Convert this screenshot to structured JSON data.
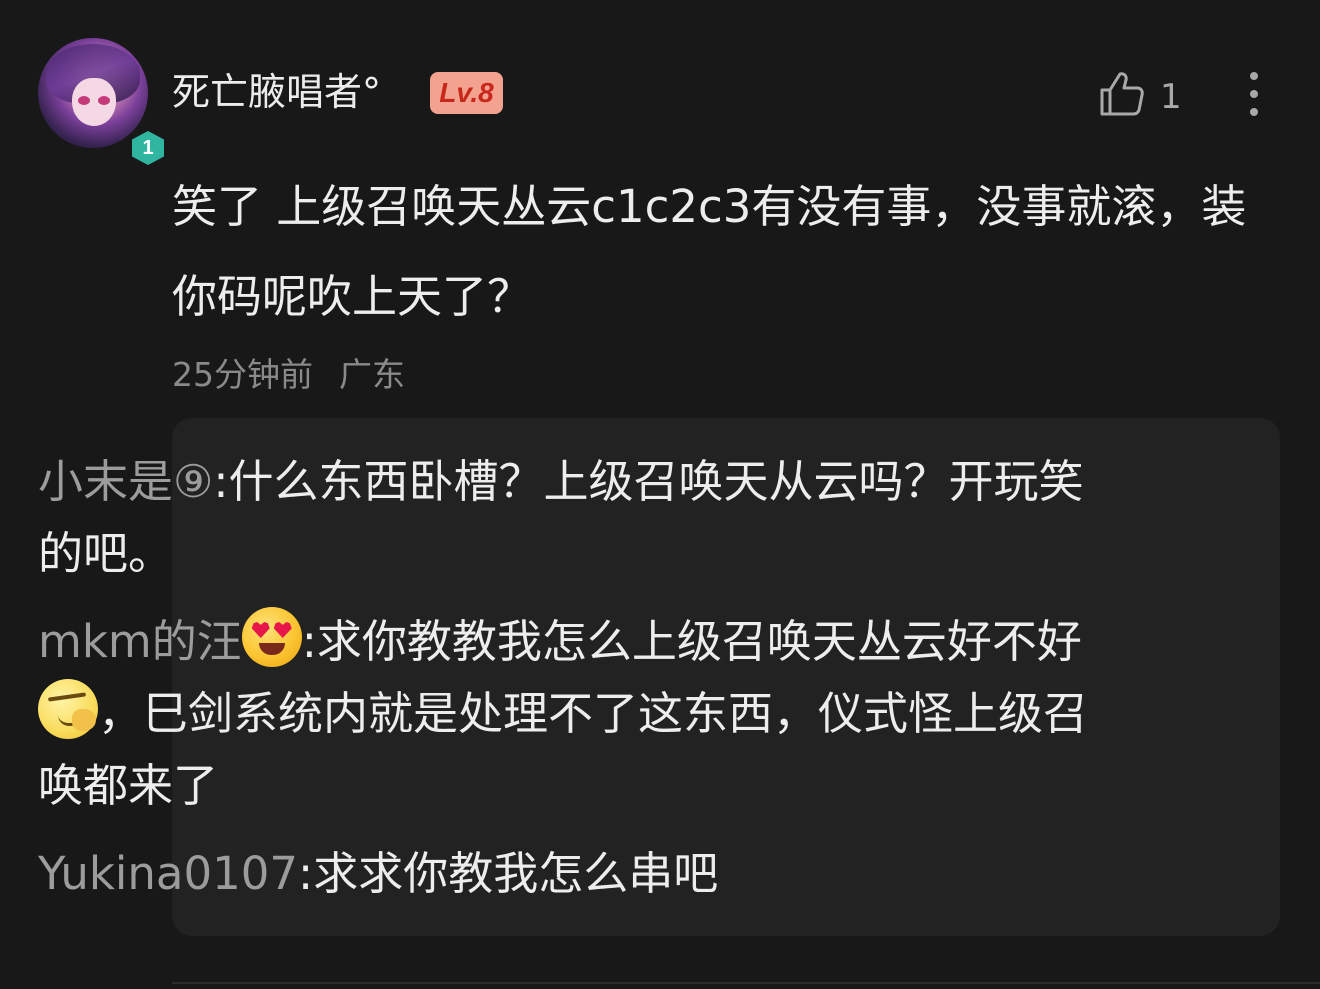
{
  "comment": {
    "author": "死亡腋唱者°",
    "avatar_badge_number": "1",
    "level_badge": "Lv.8",
    "like_count": "1",
    "text": "笑了 上级召唤天丛云c1c2c3有没有事，没事就滚，装你码呢吹上天了？",
    "time": "25分钟前",
    "location": "广东"
  },
  "replies": [
    {
      "author": "小末是⑨",
      "text": "什么东西卧槽？上级召唤天从云吗？开玩笑的吧。"
    },
    {
      "author": "mkm的汪",
      "emoji_1": "heart-eyes-emoji",
      "text_part_1": "求你教教我怎么上级召唤天丛云好不好",
      "emoji_2": "smirk-emoji",
      "text_part_2": "，巳剑系统内就是处理不了这东西，仪式怪上级召唤都来了"
    },
    {
      "author": "Yukina0107",
      "text": "求求你教我怎么串吧"
    }
  ],
  "colors": {
    "background": "#181818",
    "reply_box": "#222222",
    "level_badge_bg": "#f3a28f",
    "level_badge_text": "#c7281b",
    "avatar_badge": "#2fb5a0"
  }
}
